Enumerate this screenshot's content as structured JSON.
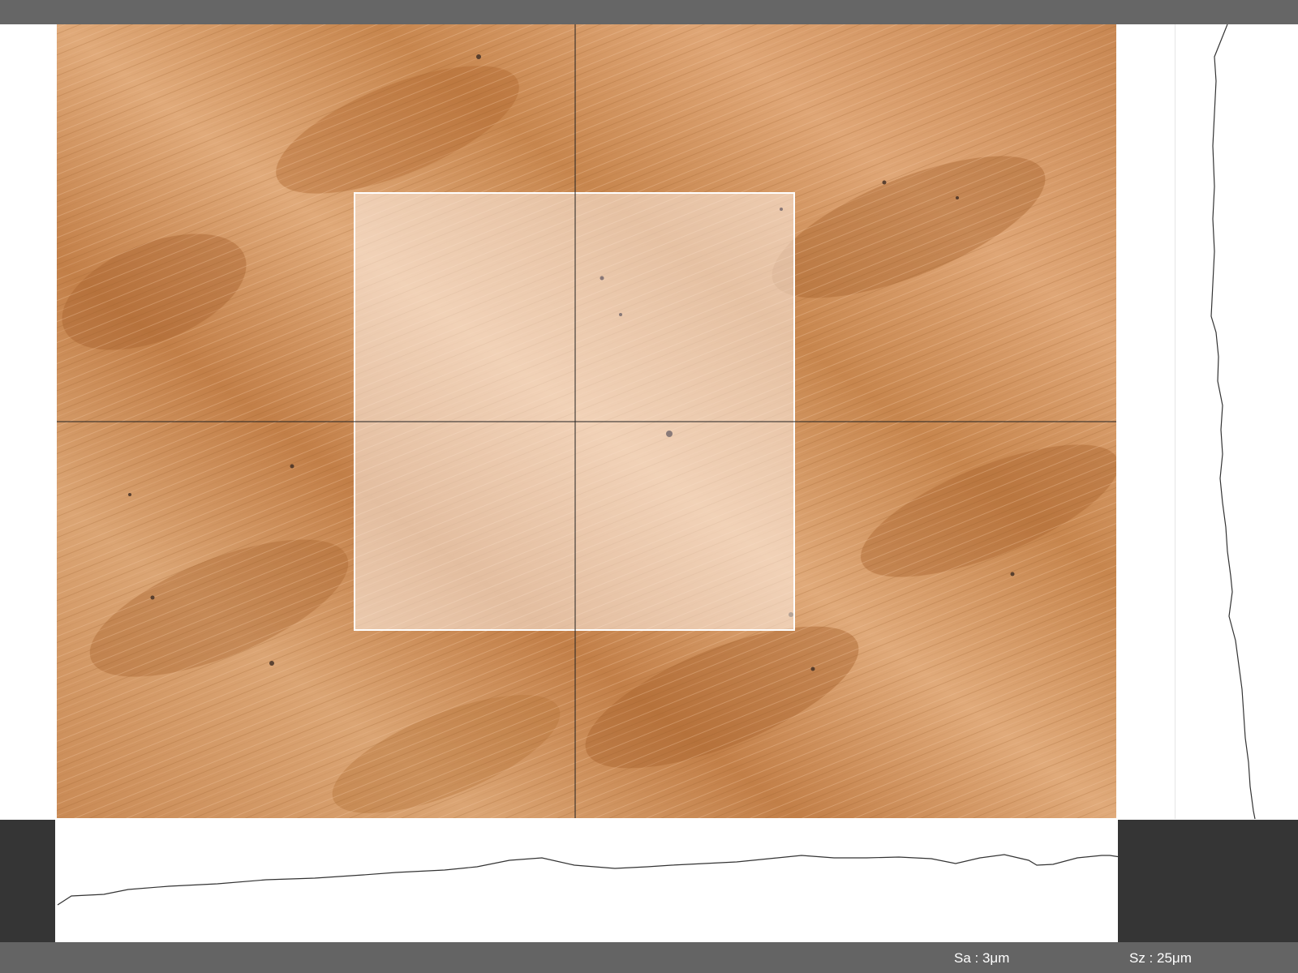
{
  "status_bar": {
    "sa": "Sa : 3μm",
    "sz": "Sz : 25μm"
  },
  "colors": {
    "title_bar": "#666666",
    "status_bar": "#646464",
    "dark_panel": "#353535",
    "wood_base": "#d49a68",
    "wood_dark": "#b8743e",
    "selection_fill": "#fff3ea",
    "crosshair": "#222222",
    "profile_line": "#333333"
  },
  "icons": {
    "crosshair": "crosshair-icon"
  }
}
